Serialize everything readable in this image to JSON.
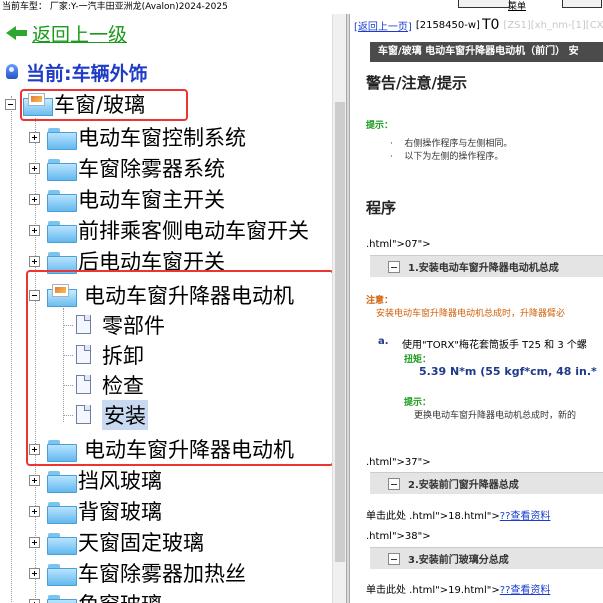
{
  "topbar": {
    "label": "当前车型： 厂家:Y-一汽丰田亚洲龙(Avalon)2024-2025",
    "button_text": "菜单"
  },
  "tree": {
    "back_label": "返回上一级",
    "current_label": "当前:车辆外饰",
    "items": [
      {
        "label": "车窗/玻璃"
      },
      {
        "label": "电动车窗控制系统"
      },
      {
        "label": "车窗除雾器系统"
      },
      {
        "label": "电动车窗主开关"
      },
      {
        "label": "前排乘客侧电动车窗开关"
      },
      {
        "label": "后电动车窗开关"
      },
      {
        "label": "电动车窗升降器电动机"
      },
      {
        "label": "零部件"
      },
      {
        "label": "拆卸"
      },
      {
        "label": "检查"
      },
      {
        "label": "安装"
      },
      {
        "label": "电动车窗升降器电动机"
      },
      {
        "label": "挡风玻璃"
      },
      {
        "label": "背窗玻璃"
      },
      {
        "label": "天窗固定玻璃"
      },
      {
        "label": "车窗除雾器加热丝"
      },
      {
        "label": "角窗玻璃"
      }
    ]
  },
  "doc": {
    "back_link": "[返回上一页]",
    "code": "[2158450-w]",
    "code_big": "T0",
    "code_grey": "[ZS1][xh_nm-[1][CX-",
    "banner": "车窗/玻璃  电动车窗升降器电动机（前门）  安",
    "heading_warning": "警告/注意/提示",
    "hint_label": "提示：",
    "hint_1": "右侧操作程序与左侧相同。",
    "hint_2": "以下为左侧的操作程序。",
    "heading_procedure": "程序",
    "frag_1": ".html\">07\">",
    "step_1": "1.安装电动车窗升降器电动机总成",
    "caution_label": "注意：",
    "caution_text": "安装电动车窗升降器电动机总成时，升降器臂必",
    "sub_a_marker": "a.",
    "sub_a_text": "使用\"TORX\"梅花套筒扳手 T25 和 3 个螺",
    "torque_label": "扭矩：",
    "torque_value": "5.39 N*m (55 kgf*cm, 48 in.*",
    "hint2_label": "提示：",
    "hint2_text": "更换电动车窗升降器电动机总成时，新的",
    "frag_2": ".html\">37\">",
    "step_2": "2.安装前门窗升降器总成",
    "click_1_prefix": "单击此处 .html\">18.html\">",
    "click_1_link": "??查看资料",
    "frag_3": ".html\">38\">",
    "step_3": "3.安装前门玻璃分总成",
    "click_2_prefix": "单击此处 .html\">19.html\">",
    "click_2_link": "??查看资料"
  }
}
